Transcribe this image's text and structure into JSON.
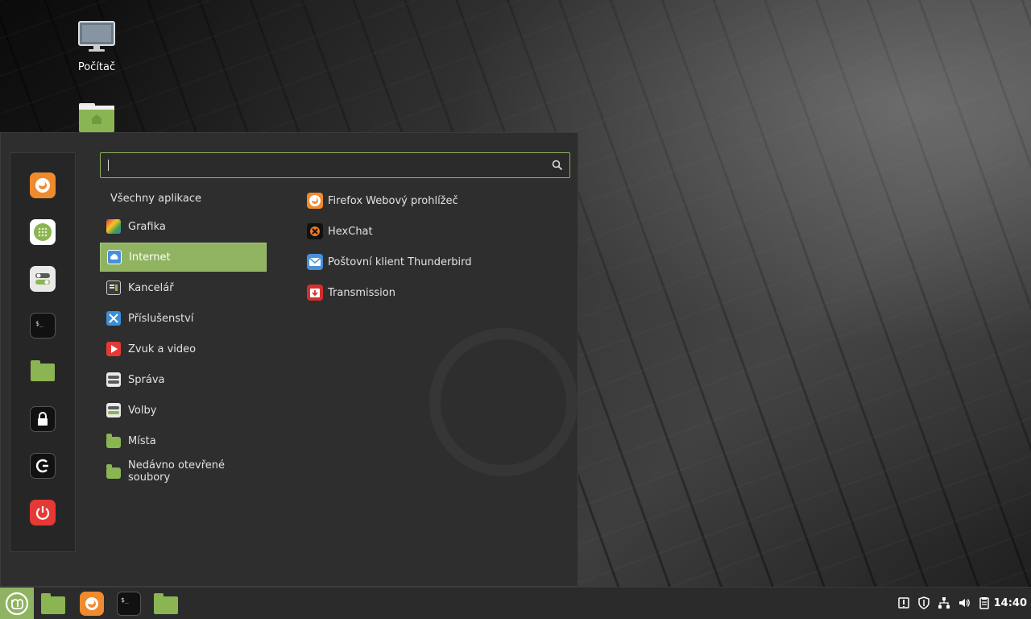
{
  "desktop": {
    "icons": [
      {
        "label": "Počítač",
        "icon": "computer-icon"
      },
      {
        "label": "",
        "icon": "home-folder-icon"
      }
    ]
  },
  "menu": {
    "search": {
      "value": "",
      "placeholder": ""
    },
    "sidebar": [
      {
        "name": "firefox",
        "icon": "firefox-icon"
      },
      {
        "name": "software-manager",
        "icon": "software-manager-icon"
      },
      {
        "name": "system-settings",
        "icon": "toggles-icon"
      },
      {
        "name": "terminal",
        "icon": "terminal-icon"
      },
      {
        "name": "files",
        "icon": "folder-icon"
      },
      {
        "name": "lock-screen",
        "icon": "lock-icon"
      },
      {
        "name": "logout",
        "icon": "logout-icon"
      },
      {
        "name": "shutdown",
        "icon": "power-icon"
      }
    ],
    "all_apps_label": "Všechny aplikace",
    "categories": [
      {
        "label": "Grafika",
        "icon": "graphics-icon"
      },
      {
        "label": "Internet",
        "icon": "cloud-icon",
        "selected": true
      },
      {
        "label": "Kancelář",
        "icon": "office-icon"
      },
      {
        "label": "Příslušenství",
        "icon": "accessories-icon"
      },
      {
        "label": "Zvuk a video",
        "icon": "play-icon"
      },
      {
        "label": "Správa",
        "icon": "administration-icon"
      },
      {
        "label": "Volby",
        "icon": "preferences-icon"
      },
      {
        "label": "Místa",
        "icon": "places-folder-icon"
      },
      {
        "label": "Nedávno otevřené soubory",
        "icon": "recent-folder-icon"
      }
    ],
    "apps": [
      {
        "label": "Firefox Webový prohlížeč",
        "icon": "firefox-icon"
      },
      {
        "label": "HexChat",
        "icon": "hexchat-icon"
      },
      {
        "label": "Poštovní klient Thunderbird",
        "icon": "thunderbird-icon"
      },
      {
        "label": "Transmission",
        "icon": "transmission-icon"
      }
    ]
  },
  "taskbar": {
    "launchers": [
      "mint-menu-icon",
      "files-icon",
      "firefox-icon",
      "terminal-icon",
      "folder-icon"
    ],
    "tray": [
      "update-icon",
      "shield-icon",
      "network-icon",
      "volume-icon",
      "clipboard-icon"
    ],
    "clock": "14:40"
  },
  "colors": {
    "accent": "#8fb360",
    "folder": "#8ab552",
    "power": "#e53935"
  }
}
